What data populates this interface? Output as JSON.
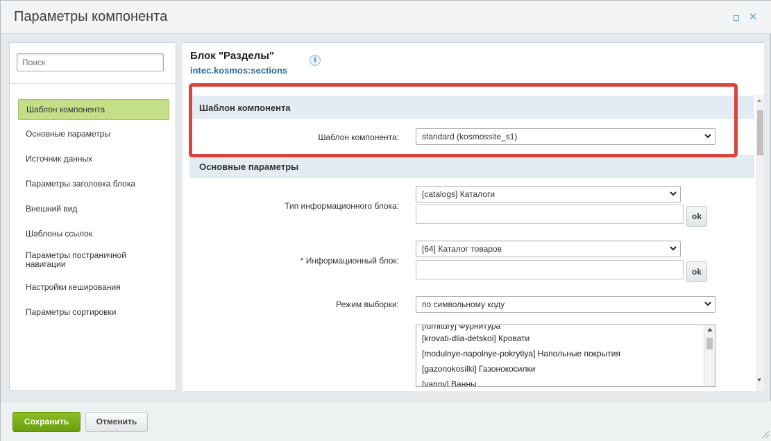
{
  "window": {
    "title": "Параметры компонента"
  },
  "sidebar": {
    "search_placeholder": "Поиск",
    "items": [
      {
        "label": "Шаблон компонента",
        "active": true
      },
      {
        "label": "Основные параметры"
      },
      {
        "label": "Источник данных"
      },
      {
        "label": "Параметры заголовка блока"
      },
      {
        "label": "Внешний вид"
      },
      {
        "label": "Шаблоны ссылок"
      },
      {
        "label": "Параметры постраничной навигации"
      },
      {
        "label": "Настройки кеширования"
      },
      {
        "label": "Параметры сортировки"
      }
    ]
  },
  "component": {
    "title": "Блок \"Разделы\"",
    "code": "intec.kosmos:sections",
    "info_icon": "i"
  },
  "sections": {
    "template": {
      "heading": "Шаблон компонента",
      "field_label": "Шаблон компонента:",
      "field_value": "standard (kosmossite_s1)"
    },
    "main": {
      "heading": "Основные параметры",
      "iblock_type_label": "Тип информационного блока:",
      "iblock_type_value": "[catalogs] Каталоги",
      "iblock_label": "* Информационный блок:",
      "iblock_value": "[64] Каталог товаров",
      "mode_label": "Режим выборки:",
      "mode_value": "по символьному коду",
      "ok_label": "ok",
      "list_items": [
        "[furnitury] Фурнитура",
        "[krovati-dlia-detskoi] Кровати",
        "[modulnye-napolnye-pokrytiya] Напольные покрытия",
        "[gazonokosilki] Газонокосилки",
        "[vanny] Ванны"
      ]
    }
  },
  "footer": {
    "save_label": "Сохранить",
    "cancel_label": "Отменить"
  },
  "colors": {
    "highlight": "#d9443c",
    "save_green": "#7aae19",
    "active_item": "#c4df87",
    "section_bg": "#e3ecf2"
  }
}
